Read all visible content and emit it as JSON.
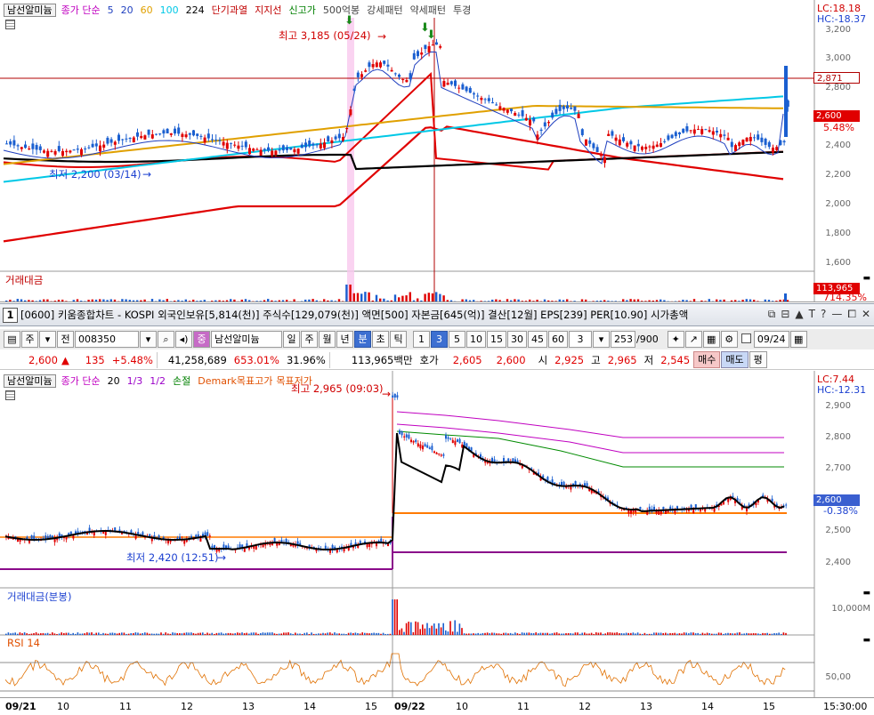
{
  "top_chart": {
    "legend": {
      "name_box": "남선알미늄",
      "ma_label": "종가 단순",
      "ma_periods": [
        "5",
        "20",
        "60",
        "100",
        "224"
      ],
      "ma_colors": [
        "#1f3fbf",
        "#1f3fbf",
        "#e0a000",
        "#00c8e6",
        "#000000"
      ],
      "items": [
        "단기과열",
        "지지선",
        "신고가",
        "500억봉",
        "강세패턴",
        "약세패턴",
        "투경"
      ],
      "item_colors": [
        "#c00000",
        "#c00000",
        "#008000",
        "#444",
        "#444",
        "#444",
        "#444"
      ]
    },
    "lc_label": "LC:18.18",
    "hc_label": "HC:-18.37",
    "y_ticks": [
      "3,200",
      "3,000",
      "2,800",
      "2,600",
      "2,400",
      "2,200",
      "2,000",
      "1,800",
      "1,600"
    ],
    "current_price_tag": "2,871",
    "last_price_tag": "2,600",
    "last_change_pct": "5.48%",
    "high_annotation": "최고 3,185 (05/24)",
    "low_annotation": "최저 2,200 (03/14)",
    "volume_label": "거래대금",
    "volume_tag": "113,965",
    "volume_pct": "714.35%",
    "colors": {
      "up": "#e00000",
      "down": "#1a5fd0",
      "ma5": "#1f3fbf",
      "ma60": "#e0a000",
      "ma100": "#00c8e6",
      "ma224": "#000000",
      "envelope": "#e00000"
    }
  },
  "titlebar": {
    "number": "1",
    "text": "[0600] 키움종합차트 - KOSPI 외국인보유[5,814(천)] 주식수[129,079(천)] 액면[500] 자본금[645(억)] 결산[12월] EPS[239] PER[10.90] 시가총액",
    "buttons": [
      "⧉",
      "⊟",
      "▲",
      "T",
      "?",
      "—",
      "⧠",
      "✕"
    ]
  },
  "toolbar": {
    "type_select": "주",
    "all_label": "전",
    "code": "008350",
    "stock_name": "남선알미늄",
    "periods": [
      "일",
      "주",
      "월",
      "년",
      "분",
      "초",
      "틱"
    ],
    "intervals": [
      "1",
      "3",
      "5",
      "10",
      "15",
      "30",
      "45",
      "60"
    ],
    "active_interval": "3",
    "count_select": "3",
    "bars_display": "253",
    "bars_total": "/900",
    "date_field": "09/24"
  },
  "infobar": {
    "price": "2,600",
    "arrow": "▲",
    "change": "135",
    "change_pct": "+5.48%",
    "volume": "41,258,689",
    "volume_ratio": "653.01%",
    "turnover_pct": "31.96%",
    "amount": "113,965백만",
    "quote_label": "호가",
    "ask": "2,605",
    "bid": "2,600",
    "open_label": "시",
    "open": "2,925",
    "high_label": "고",
    "high": "2,965",
    "low_label": "저",
    "low": "2,545",
    "buy_label": "매수",
    "sell_label": "매도",
    "even_label": "평"
  },
  "bottom_chart": {
    "legend": {
      "name_box": "남선알미늄",
      "ma_label": "종가 단순",
      "ma_period": "20",
      "items": [
        "1/3",
        "1/2",
        "손절",
        "Demark목표고가",
        "목표저가"
      ],
      "item_colors": [
        "#9b00c8",
        "#9b00c8",
        "#008000",
        "#e05000",
        "#e05000"
      ]
    },
    "lc_label": "LC:7.44",
    "hc_label": "HC:-12.31",
    "y_ticks": [
      "2,900",
      "2,800",
      "2,700",
      "2,600",
      "2,500",
      "2,400"
    ],
    "last_price_tag": "2,600",
    "last_change_pct": "-0.38%",
    "high_annotation": "최고 2,965 (09:03)",
    "low_annotation": "최저 2,420 (12:51)",
    "volume_label": "거래대금(분봉)",
    "volume_tick": "10,000M",
    "rsi_label": "RSI 14",
    "rsi_tick": "50,00",
    "time_labels": [
      "09/21",
      "10",
      "11",
      "12",
      "13",
      "14",
      "15",
      "09/22",
      "10",
      "11",
      "12",
      "13",
      "14",
      "15",
      "15:30:00"
    ]
  }
}
